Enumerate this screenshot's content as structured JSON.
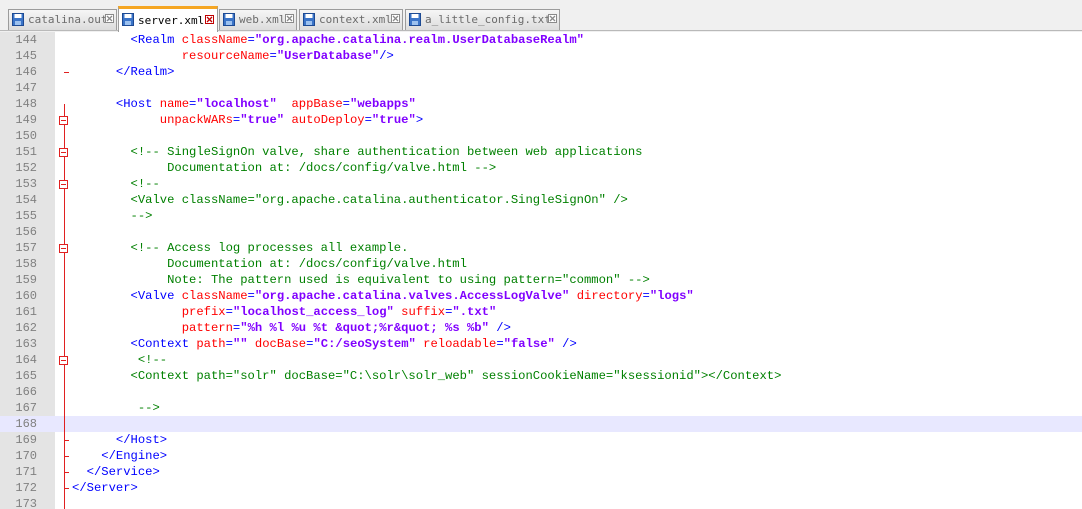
{
  "tabs": [
    {
      "label": "catalina.out",
      "active": false
    },
    {
      "label": "server.xml",
      "active": true
    },
    {
      "label": "web.xml",
      "active": false
    },
    {
      "label": "context.xml",
      "active": false
    },
    {
      "label": "a_little_config.txt",
      "active": false
    }
  ],
  "colors": {
    "tag": "#0000ff",
    "attr": "#ff0000",
    "value": "#8000ff",
    "comment": "#008000",
    "fold": "#e02020",
    "current_line": "#e8e8ff",
    "active_tab_accent": "#f5a623"
  },
  "editor": {
    "current_line": 168,
    "lines": [
      {
        "n": 144,
        "tokens": [
          [
            "p",
            "        "
          ],
          [
            "tg",
            "<Realm "
          ],
          [
            "an",
            "className"
          ],
          [
            "tg",
            "="
          ],
          [
            "av",
            "\"org.apache.catalina.realm.UserDatabaseRealm\""
          ]
        ]
      },
      {
        "n": 145,
        "tokens": [
          [
            "p",
            "               "
          ],
          [
            "an",
            "resourceName"
          ],
          [
            "tg",
            "="
          ],
          [
            "av",
            "\"UserDatabase\""
          ],
          [
            "tg",
            "/>"
          ]
        ]
      },
      {
        "n": 146,
        "tokens": [
          [
            "p",
            "      "
          ],
          [
            "tg",
            "</Realm>"
          ]
        ]
      },
      {
        "n": 147,
        "tokens": []
      },
      {
        "n": 148,
        "tokens": [
          [
            "p",
            "      "
          ],
          [
            "tg",
            "<Host "
          ],
          [
            "an",
            "name"
          ],
          [
            "tg",
            "="
          ],
          [
            "av",
            "\"localhost\""
          ],
          [
            "p",
            "  "
          ],
          [
            "an",
            "appBase"
          ],
          [
            "tg",
            "="
          ],
          [
            "av",
            "\"webapps\""
          ]
        ]
      },
      {
        "n": 149,
        "tokens": [
          [
            "p",
            "            "
          ],
          [
            "an",
            "unpackWARs"
          ],
          [
            "tg",
            "="
          ],
          [
            "av",
            "\"true\""
          ],
          [
            "p",
            " "
          ],
          [
            "an",
            "autoDeploy"
          ],
          [
            "tg",
            "="
          ],
          [
            "av",
            "\"true\""
          ],
          [
            "tg",
            ">"
          ]
        ]
      },
      {
        "n": 150,
        "tokens": []
      },
      {
        "n": 151,
        "tokens": [
          [
            "p",
            "        "
          ],
          [
            "cm",
            "<!-- SingleSignOn valve, share authentication between web applications"
          ]
        ]
      },
      {
        "n": 152,
        "tokens": [
          [
            "p",
            "             "
          ],
          [
            "cm",
            "Documentation at: /docs/config/valve.html -->"
          ]
        ]
      },
      {
        "n": 153,
        "tokens": [
          [
            "p",
            "        "
          ],
          [
            "cm",
            "<!--"
          ]
        ]
      },
      {
        "n": 154,
        "tokens": [
          [
            "p",
            "        "
          ],
          [
            "cm",
            "<Valve className=\"org.apache.catalina.authenticator.SingleSignOn\" />"
          ]
        ]
      },
      {
        "n": 155,
        "tokens": [
          [
            "p",
            "        "
          ],
          [
            "cm",
            "-->"
          ]
        ]
      },
      {
        "n": 156,
        "tokens": []
      },
      {
        "n": 157,
        "tokens": [
          [
            "p",
            "        "
          ],
          [
            "cm",
            "<!-- Access log processes all example."
          ]
        ]
      },
      {
        "n": 158,
        "tokens": [
          [
            "p",
            "             "
          ],
          [
            "cm",
            "Documentation at: /docs/config/valve.html"
          ]
        ]
      },
      {
        "n": 159,
        "tokens": [
          [
            "p",
            "             "
          ],
          [
            "cm",
            "Note: The pattern used is equivalent to using pattern=\"common\" -->"
          ]
        ]
      },
      {
        "n": 160,
        "tokens": [
          [
            "p",
            "        "
          ],
          [
            "tg",
            "<Valve "
          ],
          [
            "an",
            "className"
          ],
          [
            "tg",
            "="
          ],
          [
            "av",
            "\"org.apache.catalina.valves.AccessLogValve\""
          ],
          [
            "p",
            " "
          ],
          [
            "an",
            "directory"
          ],
          [
            "tg",
            "="
          ],
          [
            "av",
            "\"logs\""
          ]
        ]
      },
      {
        "n": 161,
        "tokens": [
          [
            "p",
            "               "
          ],
          [
            "an",
            "prefix"
          ],
          [
            "tg",
            "="
          ],
          [
            "av",
            "\"localhost_access_log\""
          ],
          [
            "p",
            " "
          ],
          [
            "an",
            "suffix"
          ],
          [
            "tg",
            "="
          ],
          [
            "av",
            "\".txt\""
          ]
        ]
      },
      {
        "n": 162,
        "tokens": [
          [
            "p",
            "               "
          ],
          [
            "an",
            "pattern"
          ],
          [
            "tg",
            "="
          ],
          [
            "av",
            "\"%h %l %u %t &quot;%r&quot; %s %b\""
          ],
          [
            "p",
            " "
          ],
          [
            "tg",
            "/>"
          ]
        ]
      },
      {
        "n": 163,
        "tokens": [
          [
            "p",
            "        "
          ],
          [
            "tg",
            "<Context "
          ],
          [
            "an",
            "path"
          ],
          [
            "tg",
            "="
          ],
          [
            "av",
            "\"\""
          ],
          [
            "p",
            " "
          ],
          [
            "an",
            "docBase"
          ],
          [
            "tg",
            "="
          ],
          [
            "av",
            "\"C:/seoSystem\""
          ],
          [
            "p",
            " "
          ],
          [
            "an",
            "reloadable"
          ],
          [
            "tg",
            "="
          ],
          [
            "av",
            "\"false\""
          ],
          [
            "p",
            " "
          ],
          [
            "tg",
            "/>"
          ]
        ]
      },
      {
        "n": 164,
        "tokens": [
          [
            "p",
            "         "
          ],
          [
            "cm",
            "<!--"
          ]
        ]
      },
      {
        "n": 165,
        "tokens": [
          [
            "p",
            "        "
          ],
          [
            "cm",
            "<Context path=\"solr\" docBase=\"C:\\solr\\solr_web\" sessionCookieName=\"ksessionid\"></Context>"
          ]
        ]
      },
      {
        "n": 166,
        "tokens": []
      },
      {
        "n": 167,
        "tokens": [
          [
            "p",
            "         "
          ],
          [
            "cm",
            "-->"
          ]
        ]
      },
      {
        "n": 168,
        "tokens": []
      },
      {
        "n": 169,
        "tokens": [
          [
            "p",
            "      "
          ],
          [
            "tg",
            "</Host>"
          ]
        ]
      },
      {
        "n": 170,
        "tokens": [
          [
            "p",
            "    "
          ],
          [
            "tg",
            "</Engine>"
          ]
        ]
      },
      {
        "n": 171,
        "tokens": [
          [
            "p",
            "  "
          ],
          [
            "tg",
            "</Service>"
          ]
        ]
      },
      {
        "n": 172,
        "tokens": [
          [
            "tg",
            "</Server>"
          ]
        ]
      },
      {
        "n": 173,
        "tokens": []
      }
    ]
  }
}
